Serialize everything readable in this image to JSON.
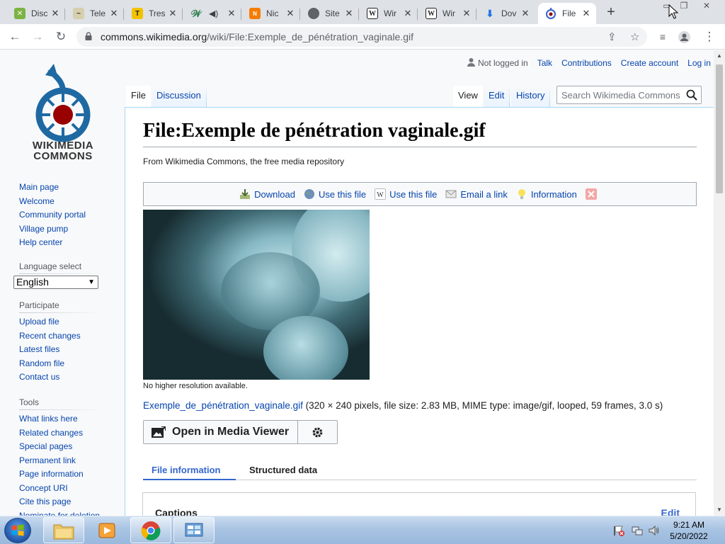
{
  "browser": {
    "tabs": [
      {
        "title": "Disc",
        "fav_color": "#8bc34a",
        "fav_char": "✕",
        "active": false
      },
      {
        "title": "Tele",
        "fav_color": "#d0c8a0",
        "fav_char": "~",
        "active": false
      },
      {
        "title": "Tres",
        "fav_color": "#222222",
        "fav_char": "T",
        "active": false
      },
      {
        "title": "",
        "fav_color": "#2e7d4f",
        "fav_char": "W",
        "active": false,
        "audio": true
      },
      {
        "title": "Nic",
        "fav_color": "#f57c00",
        "fav_char": "N",
        "active": false
      },
      {
        "title": "Site",
        "fav_color": "#5f6368",
        "fav_char": "◎",
        "active": false
      },
      {
        "title": "Wir",
        "fav_color": "#333333",
        "fav_char": "W",
        "active": false
      },
      {
        "title": "Wir",
        "fav_color": "#333333",
        "fav_char": "W",
        "active": false
      },
      {
        "title": "Dov",
        "fav_color": "#1a73e8",
        "fav_char": "⬇",
        "active": false
      },
      {
        "title": "File",
        "fav_color": "#3366cc",
        "fav_char": "◉",
        "active": true
      }
    ],
    "url_host": "commons.wikimedia.org",
    "url_path": "/wiki/File:Exemple_de_pénétration_vaginale.gif"
  },
  "site": {
    "logo_line1": "WIKIMEDIA",
    "logo_line2": "COMMONS"
  },
  "sidebar": {
    "nav": [
      "Main page",
      "Welcome",
      "Community portal",
      "Village pump",
      "Help center"
    ],
    "language_heading": "Language select",
    "language_value": "English",
    "participate_heading": "Participate",
    "participate": [
      "Upload file",
      "Recent changes",
      "Latest files",
      "Random file",
      "Contact us"
    ],
    "tools_heading": "Tools",
    "tools": [
      "What links here",
      "Related changes",
      "Special pages",
      "Permanent link",
      "Page information",
      "Concept URI",
      "Cite this page",
      "Nominate for deletion"
    ]
  },
  "personal": {
    "not_logged_in": "Not logged in",
    "talk": "Talk",
    "contributions": "Contributions",
    "create_account": "Create account",
    "log_in": "Log in"
  },
  "page_tabs": {
    "file": "File",
    "discussion": "Discussion",
    "view": "View",
    "edit": "Edit",
    "history": "History"
  },
  "search": {
    "placeholder": "Search Wikimedia Commons"
  },
  "content": {
    "title": "File:Exemple de pénétration vaginale.gif",
    "sitesub": "From Wikimedia Commons, the free media repository",
    "toc": {
      "download": "Download",
      "use_this_file_web": "Use this file",
      "use_this_file_wiki": "Use this file",
      "email_link": "Email a link",
      "information": "Information"
    },
    "no_higher_res": "No higher resolution available.",
    "file_link": "Exemple_de_pénétration_vaginale.gif",
    "file_meta": " (320 × 240 pixels, file size: 2.83 MB, MIME type: image/gif, looped, 59 frames, 3.0 s)",
    "open_media_viewer": "Open in Media Viewer",
    "subtab_file_info": "File information",
    "subtab_structured": "Structured data",
    "captions": "Captions",
    "captions_edit": "Edit"
  },
  "taskbar": {
    "time": "9:21 AM",
    "date": "5/20/2022"
  },
  "colors": {
    "link": "#0645ad",
    "accent": "#3366cc",
    "tab_strip": "#dee1e6"
  }
}
